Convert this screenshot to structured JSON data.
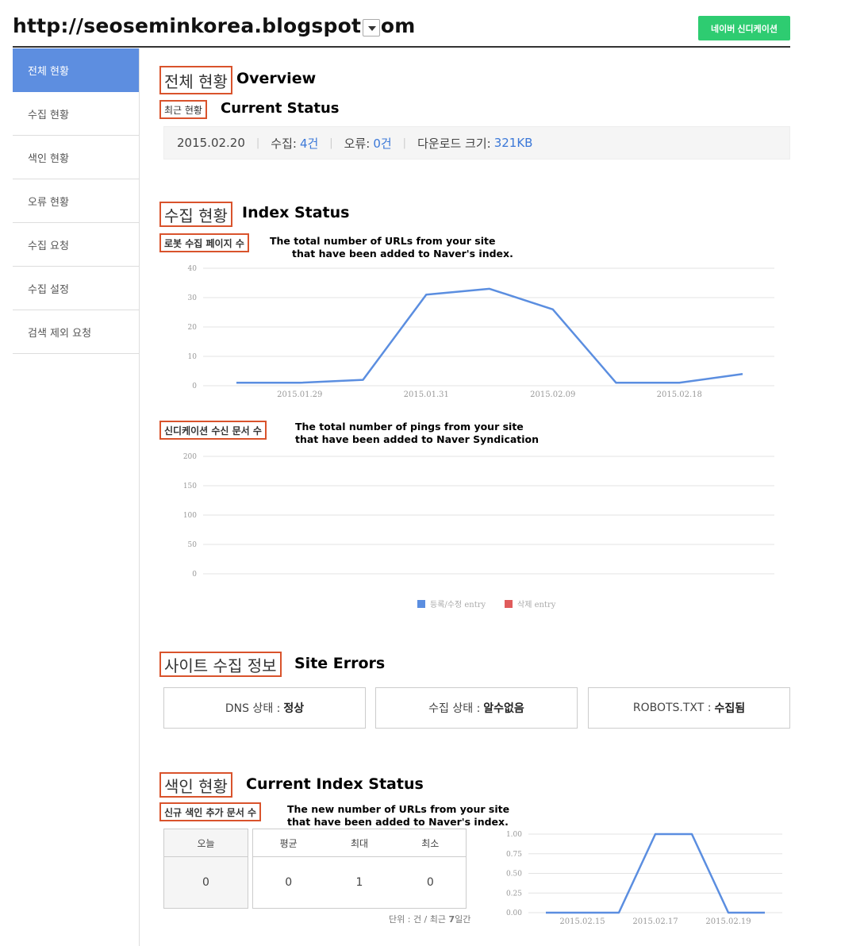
{
  "header": {
    "site_url": "http://seoseminkorea.blogspot.com",
    "syndication_button": "네이버 신디케이션"
  },
  "sidebar": {
    "items": [
      {
        "label": "전체 현황",
        "active": true
      },
      {
        "label": "수집 현황"
      },
      {
        "label": "색인 현황"
      },
      {
        "label": "오류 현황"
      },
      {
        "label": "수집 요청"
      },
      {
        "label": "수집 설정"
      },
      {
        "label": "검색 제외 요청"
      }
    ]
  },
  "overview": {
    "title_ko": "전체 현황",
    "title_en": "Overview",
    "current_ko": "최근 현황",
    "current_en": "Current Status",
    "status": {
      "date": "2015.02.20",
      "collect_label": "수집: ",
      "collect_value": "4건",
      "error_label": "오류: ",
      "error_value": "0건",
      "download_label": "다운로드 크기: ",
      "download_value": "321KB"
    }
  },
  "index_status": {
    "title_ko": "수집 현황",
    "title_en": "Index Status",
    "robot_label_ko": "로봇 수집 페이지 수",
    "robot_note_line1": "The total number of URLs from your site",
    "robot_note_line2": "that have been added to Naver's index.",
    "syn_label_ko": "신디케이션 수신 문서 수",
    "syn_note_line1": "The total number of pings from your site",
    "syn_note_line2": "that have been added to Naver Syndication"
  },
  "site_errors": {
    "title_ko": "사이트 수집 정보",
    "title_en": "Site Errors",
    "dns_label": "DNS 상태 : ",
    "dns_value": "정상",
    "collect_label": "수집 상태 : ",
    "collect_value": "알수없음",
    "robots_label": "ROBOTS.TXT : ",
    "robots_value": "수집됨"
  },
  "current_index": {
    "title_ko": "색인 현황",
    "title_en": "Current Index Status",
    "new_label_ko": "신규 색인 추가 문서 수",
    "new_note_line1": "The new number of URLs from your site",
    "new_note_line2": "that have been added to Naver's index.",
    "table": {
      "today_header": "오늘",
      "today_value": "0",
      "avg_header": "평균",
      "avg_value": "0",
      "max_header": "최대",
      "max_value": "1",
      "min_header": "최소",
      "min_value": "0"
    },
    "unit_note_prefix": "단위 : 건 / 최근 ",
    "unit_note_days": "7",
    "unit_note_suffix": "일간"
  },
  "chart_data": [
    {
      "type": "line",
      "x": [
        "2015.01.28",
        "2015.01.29",
        "2015.01.30",
        "2015.01.31",
        "2015.02.01",
        "2015.02.09",
        "2015.02.10",
        "2015.02.18",
        "2015.02.19"
      ],
      "x_tick_labels": [
        "2015.01.29",
        "2015.01.31",
        "2015.02.09",
        "2015.02.18"
      ],
      "series": [
        {
          "values": [
            1,
            1,
            2,
            31,
            33,
            26,
            1,
            1,
            4
          ],
          "color": "#5b8ee0"
        }
      ],
      "ylim": [
        0,
        40
      ],
      "yticks": [
        0,
        10,
        20,
        30,
        40
      ],
      "grid": true
    },
    {
      "type": "line",
      "x": [],
      "series": [
        {
          "name": "등록/수정 entry",
          "values": [],
          "color": "#5b8ee0"
        },
        {
          "name": "삭제 entry",
          "values": [],
          "color": "#e05b5b"
        }
      ],
      "ylim": [
        0,
        200
      ],
      "yticks": [
        0,
        50,
        100,
        150,
        200
      ],
      "grid": true,
      "legend": "bottom"
    },
    {
      "type": "line",
      "x": [
        "2015.02.14",
        "2015.02.15",
        "2015.02.16",
        "2015.02.17",
        "2015.02.18",
        "2015.02.19",
        "2015.02.20"
      ],
      "x_tick_labels": [
        "2015.02.15",
        "2015.02.17",
        "2015.02.19"
      ],
      "series": [
        {
          "values": [
            0,
            0,
            0,
            1,
            1,
            0,
            0
          ],
          "color": "#5b8ee0"
        }
      ],
      "ylim": [
        0,
        1
      ],
      "yticks": [
        "0.00",
        "0.25",
        "0.50",
        "0.75",
        "1.00"
      ],
      "grid": true
    }
  ]
}
